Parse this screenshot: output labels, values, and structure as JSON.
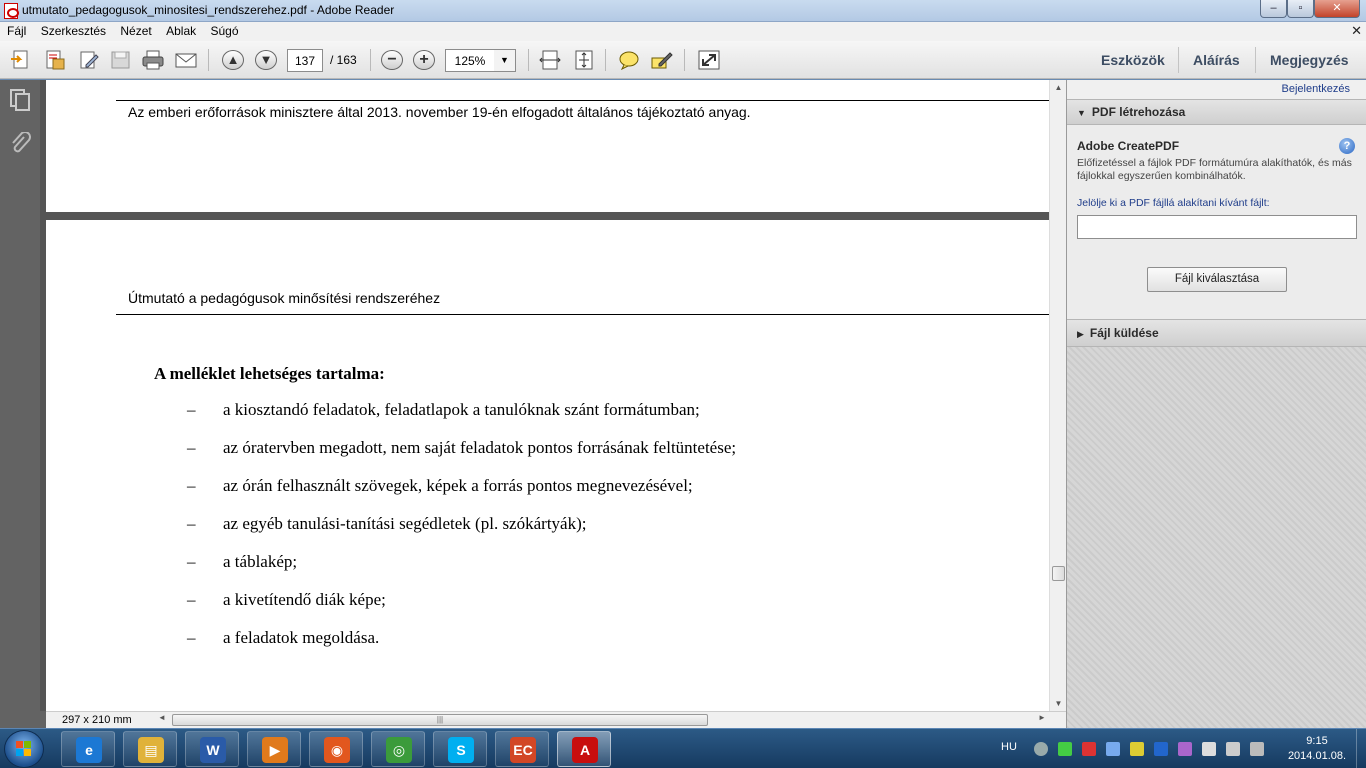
{
  "window": {
    "title": "utmutato_pedagogusok_minositesi_rendszerehez.pdf - Adobe Reader",
    "minimize_glyph": "–",
    "maximize_glyph": "▫",
    "close_glyph": "✕"
  },
  "menubar": {
    "items": [
      "Fájl",
      "Szerkesztés",
      "Nézet",
      "Ablak",
      "Súgó"
    ],
    "close_glyph": "✕"
  },
  "toolbar": {
    "page_current": "137",
    "page_total": "/ 163",
    "zoom": "125%",
    "zoom_minus": "−",
    "zoom_plus": "+",
    "prev_page_glyph": "▲",
    "next_page_glyph": "▼",
    "dropdown_glyph": "▼",
    "links": [
      "Eszközök",
      "Aláírás",
      "Megjegyzés"
    ]
  },
  "document": {
    "page1_text": "Az emberi erőforrások minisztere által 2013. november 19-én elfogadott általános tájékoztató anyag.",
    "page2_header": "Útmutató a pedagógusok minősítési rendszeréhez",
    "heading": "A melléklet lehetséges tartalma:",
    "bullet_dash": "–",
    "bullets": [
      "a kiosztandó feladatok, feladatlapok a tanulóknak szánt formátumban;",
      "az óratervben megadott, nem saját feladatok pontos forrásának feltüntetése;",
      "az órán felhasznált szövegek, képek a forrás pontos megnevezésével;",
      "az egyéb tanulási-tanítási segédletek (pl. szókártyák);",
      "a táblakép;",
      "a kivetítendő diák képe;",
      "a feladatok megoldása."
    ]
  },
  "scroll": {
    "up_glyph": "▲",
    "down_glyph": "▼",
    "left_glyph": "◄",
    "right_glyph": "►",
    "vertical_position": 0.8,
    "horizontal_thumb_grip": "|||"
  },
  "statusbar": {
    "page_size": "297 x 210 mm"
  },
  "rightpanel": {
    "login_link": "Bejelentkezés",
    "section1_title": "PDF létrehozása",
    "section1_arrow": "▼",
    "service_title": "Adobe CreatePDF",
    "help_glyph": "?",
    "description": "Előfizetéssel a fájlok PDF formátumúra alakíthatók, és más fájlokkal egyszerűen kombinálhatók.",
    "field_label": "Jelölje ki a PDF fájllá alakítani kívánt fájlt:",
    "field_value": "",
    "button_label": "Fájl kiválasztása",
    "section2_title": "Fájl küldése",
    "section2_arrow": "▶"
  },
  "taskbar": {
    "apps": [
      {
        "name": "internet-explorer",
        "glyph": "e",
        "color": "#1c78d4"
      },
      {
        "name": "windows-explorer",
        "glyph": "▤",
        "color": "#e0b23a"
      },
      {
        "name": "microsoft-word",
        "glyph": "W",
        "color": "#2a5ba8"
      },
      {
        "name": "media-player",
        "glyph": "▶",
        "color": "#e07a1c"
      },
      {
        "name": "firefox",
        "glyph": "◉",
        "color": "#e2571e"
      },
      {
        "name": "chrome",
        "glyph": "◎",
        "color": "#3b9b3b"
      },
      {
        "name": "skype",
        "glyph": "S",
        "color": "#00aff0"
      },
      {
        "name": "presentation-app",
        "glyph": "EC",
        "color": "#d24726"
      },
      {
        "name": "adobe-reader",
        "glyph": "A",
        "color": "#c80e0e"
      }
    ],
    "active_app": "adobe-reader",
    "language": "HU",
    "time": "9:15",
    "date": "2014.01.08."
  },
  "colors": {
    "accent_link": "#1f3d8a",
    "reader_red": "#c80e0e",
    "doc_background": "#555555"
  }
}
